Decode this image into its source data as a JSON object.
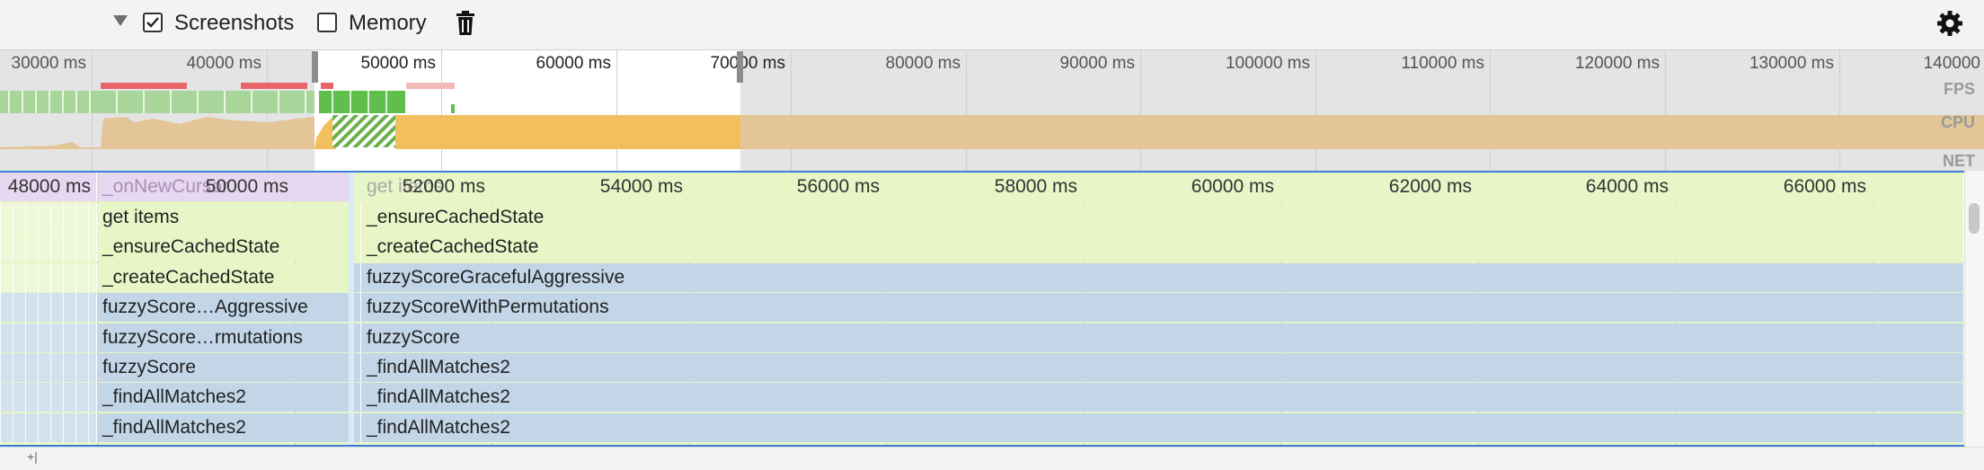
{
  "toolbar": {
    "screenshots_label": "Screenshots",
    "screenshots_checked": true,
    "memory_label": "Memory",
    "memory_checked": false
  },
  "overview": {
    "ticks": [
      "30000 ms",
      "40000 ms",
      "50000 ms",
      "60000 ms",
      "70000 ms",
      "80000 ms",
      "90000 ms",
      "100000 ms",
      "110000 ms",
      "120000 ms",
      "130000 ms",
      "140000"
    ],
    "fps_label": "FPS",
    "cpu_label": "CPU",
    "net_label": "NET"
  },
  "flame": {
    "ticks": [
      "48000 ms",
      "50000 ms",
      "52000 ms",
      "54000 ms",
      "56000 ms",
      "58000 ms",
      "60000 ms",
      "62000 ms",
      "64000 ms",
      "66000 ms"
    ],
    "header_left": "_onNewCursor",
    "header_right": "get items",
    "left_col": [
      "get items",
      "_ensureCachedState",
      "_createCachedState",
      "fuzzyScore…Aggressive",
      "fuzzyScore…rmutations",
      "fuzzyScore",
      "_findAllMatches2",
      "_findAllMatches2"
    ],
    "right_col": [
      "_ensureCachedState",
      "_createCachedState",
      "fuzzyScoreGracefulAggressive",
      "fuzzyScoreWithPermutations",
      "fuzzyScore",
      "_findAllMatches2",
      "_findAllMatches2",
      "_findAllMatches2"
    ]
  },
  "colors": {
    "green_frame": "#e8f5c6",
    "blue_frame": "#c2d6e8",
    "purple_frame": "#e8d7f0",
    "cpu_yellow": "#f2bf5e",
    "cpu_tan": "#e3c597",
    "fps_green": "#86c97a",
    "red_marker": "#e8666a",
    "selection_blue": "#3b7fd8"
  },
  "bottom_text": "+|"
}
